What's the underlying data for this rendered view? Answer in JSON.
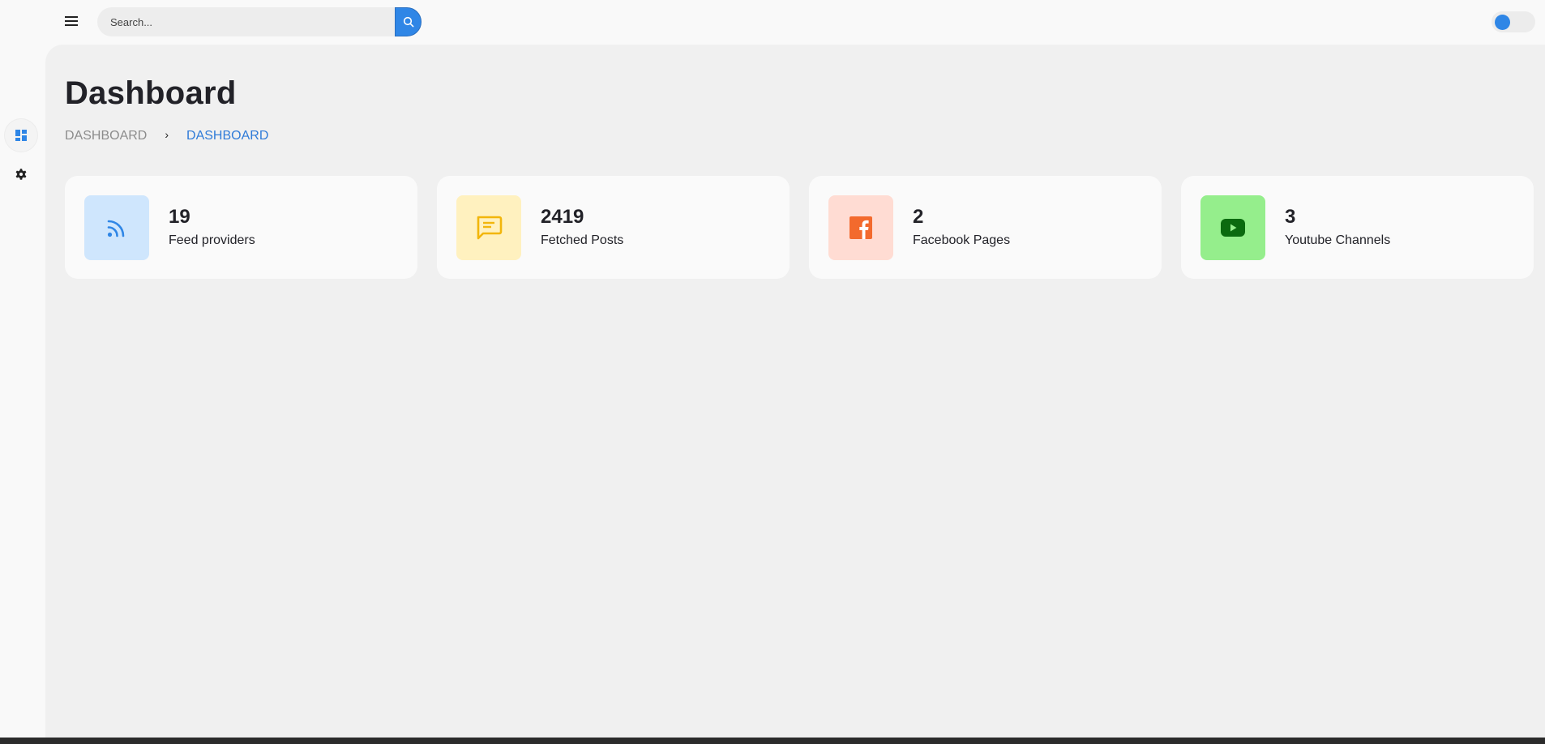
{
  "topbar": {
    "search_placeholder": "Search...",
    "menu_icon": "hamburger-icon",
    "search_icon": "magnifier-icon",
    "theme_toggle_color": "#2f86e6"
  },
  "sidebar": {
    "items": [
      {
        "icon": "dashboard-grid-icon",
        "active": true
      },
      {
        "icon": "gear-icon",
        "active": false
      }
    ]
  },
  "page": {
    "title": "Dashboard",
    "breadcrumb": [
      "DASHBOARD",
      "DASHBOARD"
    ]
  },
  "stats": [
    {
      "value": "19",
      "label": "Feed providers",
      "icon": "rss-icon",
      "bg": "#cfe6fd",
      "fg": "#2f86e6"
    },
    {
      "value": "2419",
      "label": "Fetched Posts",
      "icon": "chat-bubble-icon",
      "bg": "#fff1bf",
      "fg": "#f2b60c"
    },
    {
      "value": "2",
      "label": "Facebook Pages",
      "icon": "facebook-icon",
      "bg": "#ffdcd3",
      "fg": "#f36a2d"
    },
    {
      "value": "3",
      "label": "Youtube Channels",
      "icon": "youtube-icon",
      "bg": "#95ee8c",
      "fg": "#0b6a0f"
    }
  ],
  "colors": {
    "accent": "#2f86e6",
    "background": "#f0f0f0",
    "card": "#fafafa"
  }
}
